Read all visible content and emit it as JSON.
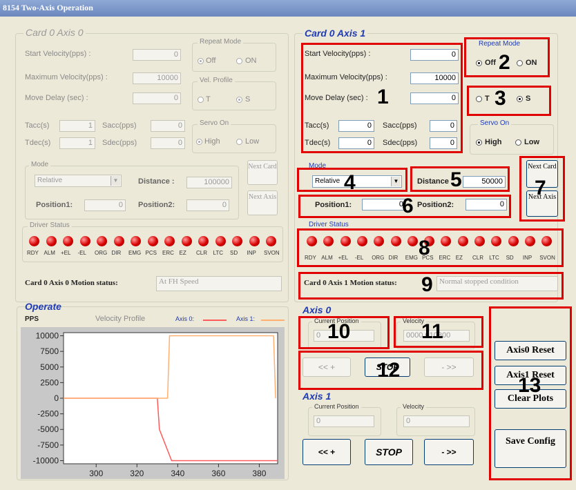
{
  "window": {
    "title": "8154 Two-Axis Operation"
  },
  "axis0_panel": {
    "title": "Card 0 Axis 0",
    "start_velocity_label": "Start Velocity(pps) :",
    "start_velocity": "0",
    "max_velocity_label": "Maximum  Velocity(pps) :",
    "max_velocity": "10000",
    "move_delay_label": "Move Delay (sec) :",
    "move_delay": "0",
    "tacc_label": "Tacc(s)",
    "tacc": "1",
    "sacc_label": "Sacc(pps)",
    "sacc": "0",
    "tdec_label": "Tdec(s)",
    "tdec": "1",
    "sdec_label": "Sdec(pps)",
    "sdec": "0",
    "repeat_mode_title": "Repeat Mode",
    "repeat_off": "Off",
    "repeat_on": "ON",
    "vel_profile_title": "Vel. Profile",
    "vel_t": "T",
    "vel_s": "S",
    "servo_on_title": "Servo On",
    "servo_high": "High",
    "servo_low": "Low",
    "mode_title": "Mode",
    "mode_value": "Relative",
    "distance_label": "Distance :",
    "distance": "100000",
    "position1_label": "Position1:",
    "position1": "0",
    "position2_label": "Position2:",
    "position2": "0",
    "next_card": "Next Card",
    "next_axis": "Next Axis",
    "driver_status_title": "Driver Status",
    "motion_status_label": "Card 0 Axis 0 Motion status:",
    "motion_status": "At FH Speed"
  },
  "axis1_panel": {
    "title": "Card 0 Axis 1",
    "start_velocity_label": "Start Velocity(pps) :",
    "start_velocity": "0",
    "max_velocity_label": "Maximum  Velocity(pps) :",
    "max_velocity": "10000",
    "move_delay_label": "Move Delay (sec) :",
    "move_delay": "0",
    "tacc_label": "Tacc(s)",
    "tacc": "0",
    "sacc_label": "Sacc(pps)",
    "sacc": "0",
    "tdec_label": "Tdec(s)",
    "tdec": "0",
    "sdec_label": "Sdec(pps)",
    "sdec": "0",
    "repeat_mode_title": "Repeat Mode",
    "repeat_off": "Off",
    "repeat_on": "ON",
    "vel_t": "T",
    "vel_s": "S",
    "servo_on_title": "Servo On",
    "servo_high": "High",
    "servo_low": "Low",
    "mode_title": "Mode",
    "mode_value": "Relative",
    "distance_label": "Distance",
    "distance": "50000",
    "position1_label": "Position1:",
    "position1": "0",
    "position2_label": "Position2:",
    "position2": "0",
    "next_card": "Next Card",
    "next_axis": "Next Axis",
    "driver_status_title": "Driver Status",
    "motion_status_label": "Card 0 Axis 1 Motion status:",
    "motion_status": "Normal stopped condition"
  },
  "led_labels": [
    "RDY",
    "ALM",
    "+EL",
    "-EL",
    "ORG",
    "DIR",
    "EMG",
    "PCS",
    "ERC",
    "EZ",
    "CLR",
    "LTC",
    "SD",
    "INP",
    "SVON"
  ],
  "operate": {
    "title": "Operate",
    "pps_label": "PPS",
    "velocity_profile_label": "Velocity Profile",
    "legend_axis0": "Axis 0:",
    "legend_axis1": "Axis 1:"
  },
  "chart_data": {
    "type": "line",
    "y_ticks": [
      "10000",
      "7500",
      "5000",
      "2500",
      "0",
      "-2500",
      "-5000",
      "-7500",
      "-10000"
    ],
    "x_ticks": [
      "300",
      "320",
      "340",
      "360",
      "380"
    ],
    "xlim": [
      284,
      389
    ],
    "ylim": [
      -10500,
      10500
    ],
    "series": [
      {
        "name": "Axis 0:",
        "color": "#ff5a5a",
        "x": [
          284,
          330,
          331,
          337,
          389
        ],
        "y": [
          0,
          0,
          -5000,
          -10000,
          -10000
        ]
      },
      {
        "name": "Axis 1:",
        "color": "#ffb070",
        "x": [
          284,
          335,
          336,
          387,
          388
        ],
        "y": [
          0,
          0,
          10000,
          10000,
          0
        ]
      }
    ]
  },
  "operate_axis0": {
    "title": "Axis 0",
    "current_position_label": "Current Position",
    "current_position": "0",
    "velocity_label": "Velocity",
    "velocity": "0000 010300",
    "jog_minus": "<< +",
    "stop": "STOP",
    "jog_plus": "- >>"
  },
  "operate_axis1": {
    "title": "Axis 1",
    "current_position_label": "Current Position",
    "current_position": "0",
    "velocity_label": "Velocity",
    "velocity": "0",
    "jog_minus": "<< +",
    "stop": "STOP",
    "jog_plus": "- >>"
  },
  "right_buttons": {
    "axis0_reset": "Axis0 Reset",
    "axis1_reset": "Axis1 Reset",
    "clear_plots": "Clear Plots",
    "save_config": "Save Config"
  },
  "annotations": [
    "1",
    "2",
    "3",
    "4",
    "5",
    "6",
    "7",
    "8",
    "9",
    "10",
    "11",
    "12",
    "13"
  ],
  "annotation_color": "#e00000"
}
